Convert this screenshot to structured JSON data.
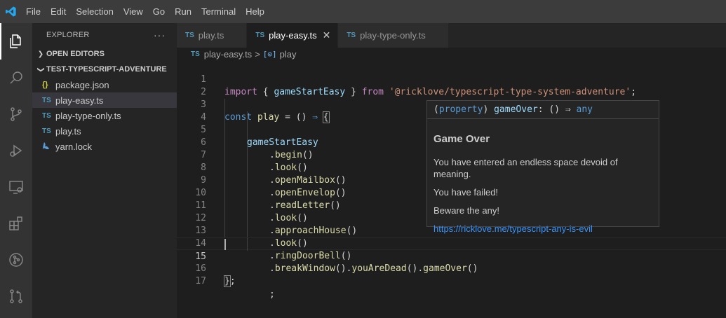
{
  "menu": [
    "File",
    "Edit",
    "Selection",
    "View",
    "Go",
    "Run",
    "Terminal",
    "Help"
  ],
  "sidebar": {
    "title": "EXPLORER",
    "more": "···",
    "open_editors": "OPEN EDITORS",
    "folder": "TEST-TYPESCRIPT-ADVENTURE",
    "files": [
      {
        "icon": "{}",
        "name": "package.json"
      },
      {
        "icon": "TS",
        "name": "play-easy.ts"
      },
      {
        "icon": "TS",
        "name": "play-type-only.ts"
      },
      {
        "icon": "TS",
        "name": "play.ts"
      },
      {
        "icon": "yarn-icon",
        "name": "yarn.lock"
      }
    ]
  },
  "tabs": [
    {
      "icon": "TS",
      "label": "play.ts"
    },
    {
      "icon": "TS",
      "label": "play-easy.ts",
      "close": "✕"
    },
    {
      "icon": "TS",
      "label": "play-type-only.ts"
    }
  ],
  "breadcrumb": {
    "icon": "TS",
    "file": "play-easy.ts",
    "sep": ">",
    "symbol_icon": "[⊙]",
    "symbol": "play"
  },
  "editor": {
    "line_numbers": [
      "1",
      "2",
      "3",
      "4",
      "5",
      "6",
      "7",
      "8",
      "9",
      "10",
      "11",
      "12",
      "13",
      "14",
      "15",
      "16",
      "17"
    ],
    "l1": {
      "kw": "import",
      "p1": " { ",
      "id": "gameStartEasy",
      "p2": " } ",
      "kw2": "from",
      "sp": " ",
      "str": "'@ricklove/typescript-type-system-adventure'",
      "end": ";"
    },
    "l3": {
      "kw": "const",
      "sp": " ",
      "id": "play",
      "eq": " = () ",
      "arrow": "⇒",
      "sp2": " ",
      "brace": "{"
    },
    "l4": {
      "id": "gameStartEasy"
    },
    "calls": [
      {
        "dot": ".",
        "fn": "begin",
        "paren": "()"
      },
      {
        "dot": ".",
        "fn": "look",
        "paren": "()"
      },
      {
        "dot": ".",
        "fn": "openMailbox",
        "paren": "()"
      },
      {
        "dot": ".",
        "fn": "openEnvelop",
        "paren": "()"
      },
      {
        "dot": ".",
        "fn": "readLetter",
        "paren": "()"
      },
      {
        "dot": ".",
        "fn": "look",
        "paren": "()"
      },
      {
        "dot": ".",
        "fn": "approachHouse",
        "paren": "()"
      },
      {
        "dot": ".",
        "fn": "look",
        "paren": "()"
      },
      {
        "dot": ".",
        "fn": "ringDoorBell",
        "paren": "()"
      }
    ],
    "l14": {
      "d1": ".",
      "f1": "breakWindow",
      "p1": "()",
      "d2": ".",
      "f2": "youAreDead",
      "p2": "()",
      "d3": ".",
      "f3": "gameOver",
      "p3": "()"
    },
    "l15": {
      "semi": ";"
    },
    "l16": {
      "brace": "}",
      "semi": ";"
    }
  },
  "hover": {
    "sig_open": "(",
    "sig_kind": "property",
    "sig_close": ") ",
    "sig_name": "gameOver",
    "sig_type": ": () ⇒ ",
    "sig_any": "any",
    "title": "Game Over",
    "p1": "You have entered an endless space devoid of meaning.",
    "p2": "You have failed!",
    "p3": "Beware the any!",
    "link": "https://ricklove.me/typescript-any-is-evil"
  },
  "colors": {
    "accent": "#007acc",
    "link": "#3794ff",
    "keyword": "#569cd6",
    "control": "#c586c0",
    "string": "#ce9178",
    "function": "#dcdcaa",
    "variable": "#9cdcfe"
  }
}
